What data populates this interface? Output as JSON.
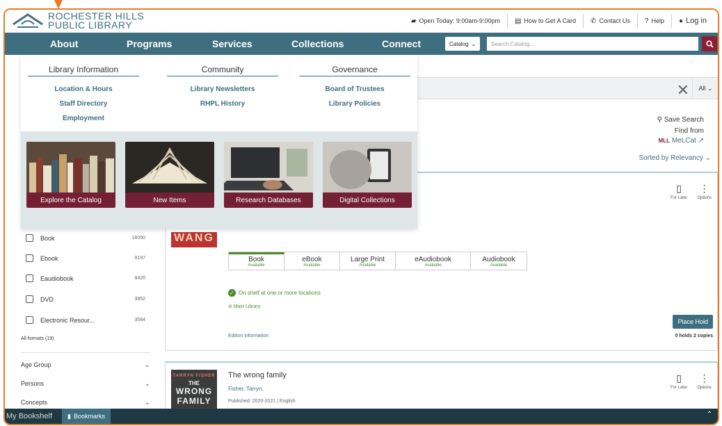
{
  "header": {
    "logo_line1": "ROCHESTER HILLS",
    "logo_line2": "PUBLIC LIBRARY",
    "open_today": "Open Today: 9:00am-9:00pm",
    "how_to_card": "How to Get A Card",
    "contact": "Contact Us",
    "help": "Help",
    "login": "Log in"
  },
  "nav": {
    "items": [
      "About",
      "Programs",
      "Services",
      "Collections",
      "Connect"
    ],
    "catalog_select": "Catalog",
    "search_placeholder": "Search Catalog..."
  },
  "dropdown": {
    "columns": [
      {
        "heading": "Library Information",
        "links": [
          "Location & Hours",
          "Staff Directory",
          "Employment"
        ]
      },
      {
        "heading": "Community",
        "links": [
          "Library Newsletters",
          "RHPL History"
        ]
      },
      {
        "heading": "Governance",
        "links": [
          "Board of Trustees",
          "Library Policies"
        ]
      }
    ],
    "tiles": [
      "Explore the Catalog",
      "New Items",
      "Research Databases",
      "Digital Collections"
    ]
  },
  "search": {
    "scope": "All",
    "save_search": "Save Search",
    "find_from": "Find from",
    "melcat": "MeLCat",
    "sorted": "Sorted by Relevancy"
  },
  "facets": {
    "formats": [
      {
        "label": "Book",
        "count": "16050"
      },
      {
        "label": "Ebook",
        "count": "9197"
      },
      {
        "label": "Eaudiobook",
        "count": "8420"
      },
      {
        "label": "DVD",
        "count": "3852"
      },
      {
        "label": "Electronic Resour...",
        "count": "3584"
      }
    ],
    "all_formats": "All formats (19)",
    "groups": [
      "Age Group",
      "Persons",
      "Concepts"
    ]
  },
  "result1": {
    "cover_text": "WANG",
    "for_later": "For Later",
    "options": "Options",
    "formats": [
      {
        "name": "Book",
        "status": "Available"
      },
      {
        "name": "eBook",
        "status": "Available"
      },
      {
        "name": "Large Print",
        "status": "Available"
      },
      {
        "name": "eAudiobook",
        "status": "Available"
      },
      {
        "name": "Audiobook",
        "status": "Available"
      }
    ],
    "on_shelf": "On shelf at one or more locations",
    "main_library": "Main Library",
    "edition_info": "Edition information",
    "place_hold": "Place Hold",
    "holds": "0 holds",
    "copies": "2 copies"
  },
  "result2": {
    "title": "The wrong family",
    "author": "Fisher, Tarryn.",
    "published": "Published: 2020-2021 | English",
    "cover_author": "TARRYN FISHER",
    "cover_the": "THE",
    "cover_wrong": "WRONG",
    "cover_family": "FAMILY",
    "for_later": "For Later",
    "options": "Options"
  },
  "bottom": {
    "title": "My Bookshelf",
    "tab": "Bookmarks"
  },
  "colors": {
    "brand_teal": "#3e6f80",
    "brand_maroon": "#742034",
    "frame_orange": "#e77b27",
    "available_green": "#4c8b2b"
  }
}
